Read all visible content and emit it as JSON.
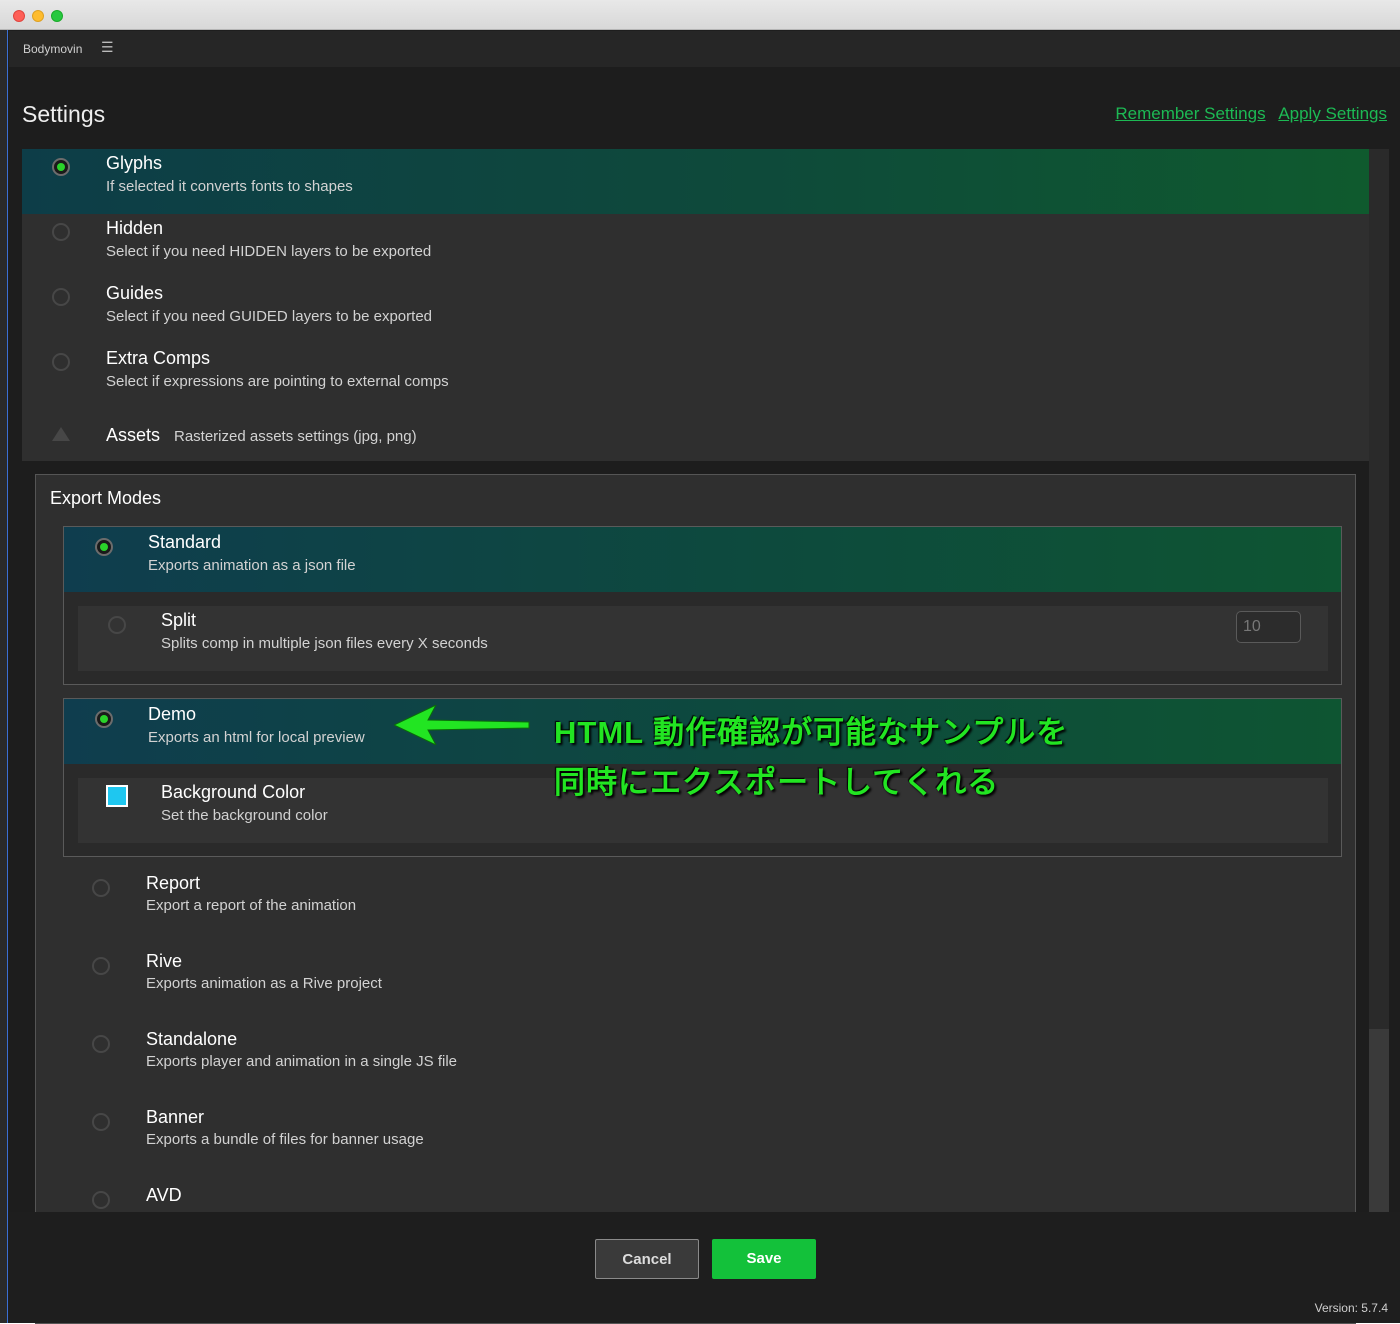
{
  "panel": {
    "name": "Bodymovin",
    "menu_icon": "hamburger-icon"
  },
  "header": {
    "title": "Settings",
    "remember": "Remember Settings",
    "apply": "Apply Settings"
  },
  "settings": [
    {
      "title": "Glyphs",
      "desc": "If selected it converts fonts to shapes",
      "selected": true
    },
    {
      "title": "Hidden",
      "desc": "Select if you need HIDDEN layers to be exported",
      "selected": false
    },
    {
      "title": "Guides",
      "desc": "Select if you need GUIDED layers to be exported",
      "selected": false
    },
    {
      "title": "Extra Comps",
      "desc": "Select if expressions are pointing to external comps",
      "selected": false
    }
  ],
  "assets": {
    "title": "Assets",
    "desc": "Rasterized assets settings (jpg, png)"
  },
  "export": {
    "title": "Export Modes",
    "standard": {
      "title": "Standard",
      "desc": "Exports animation as a json file"
    },
    "split": {
      "title": "Split",
      "desc": "Splits comp in multiple json files every X seconds",
      "placeholder": "10"
    },
    "demo": {
      "title": "Demo",
      "desc": "Exports an html for local preview"
    },
    "bgcolor": {
      "title": "Background Color",
      "desc": "Set the background color",
      "color": "#1ec7f0"
    },
    "others": [
      {
        "title": "Report",
        "desc": "Export a report of the animation"
      },
      {
        "title": "Rive",
        "desc": "Exports animation as a Rive project"
      },
      {
        "title": "Standalone",
        "desc": "Exports player and animation in a single JS file"
      },
      {
        "title": "Banner",
        "desc": "Exports a bundle of files for banner usage"
      },
      {
        "title": "AVD",
        "desc": ""
      }
    ]
  },
  "annotation": {
    "line1": "HTML 動作確認が可能なサンプルを",
    "line2": "同時にエクスポートしてくれる"
  },
  "buttons": {
    "cancel": "Cancel",
    "save": "Save"
  },
  "version": "Version: 5.7.4",
  "colors": {
    "accent": "#1db954",
    "save": "#13c13a",
    "annotation": "#22e522"
  }
}
